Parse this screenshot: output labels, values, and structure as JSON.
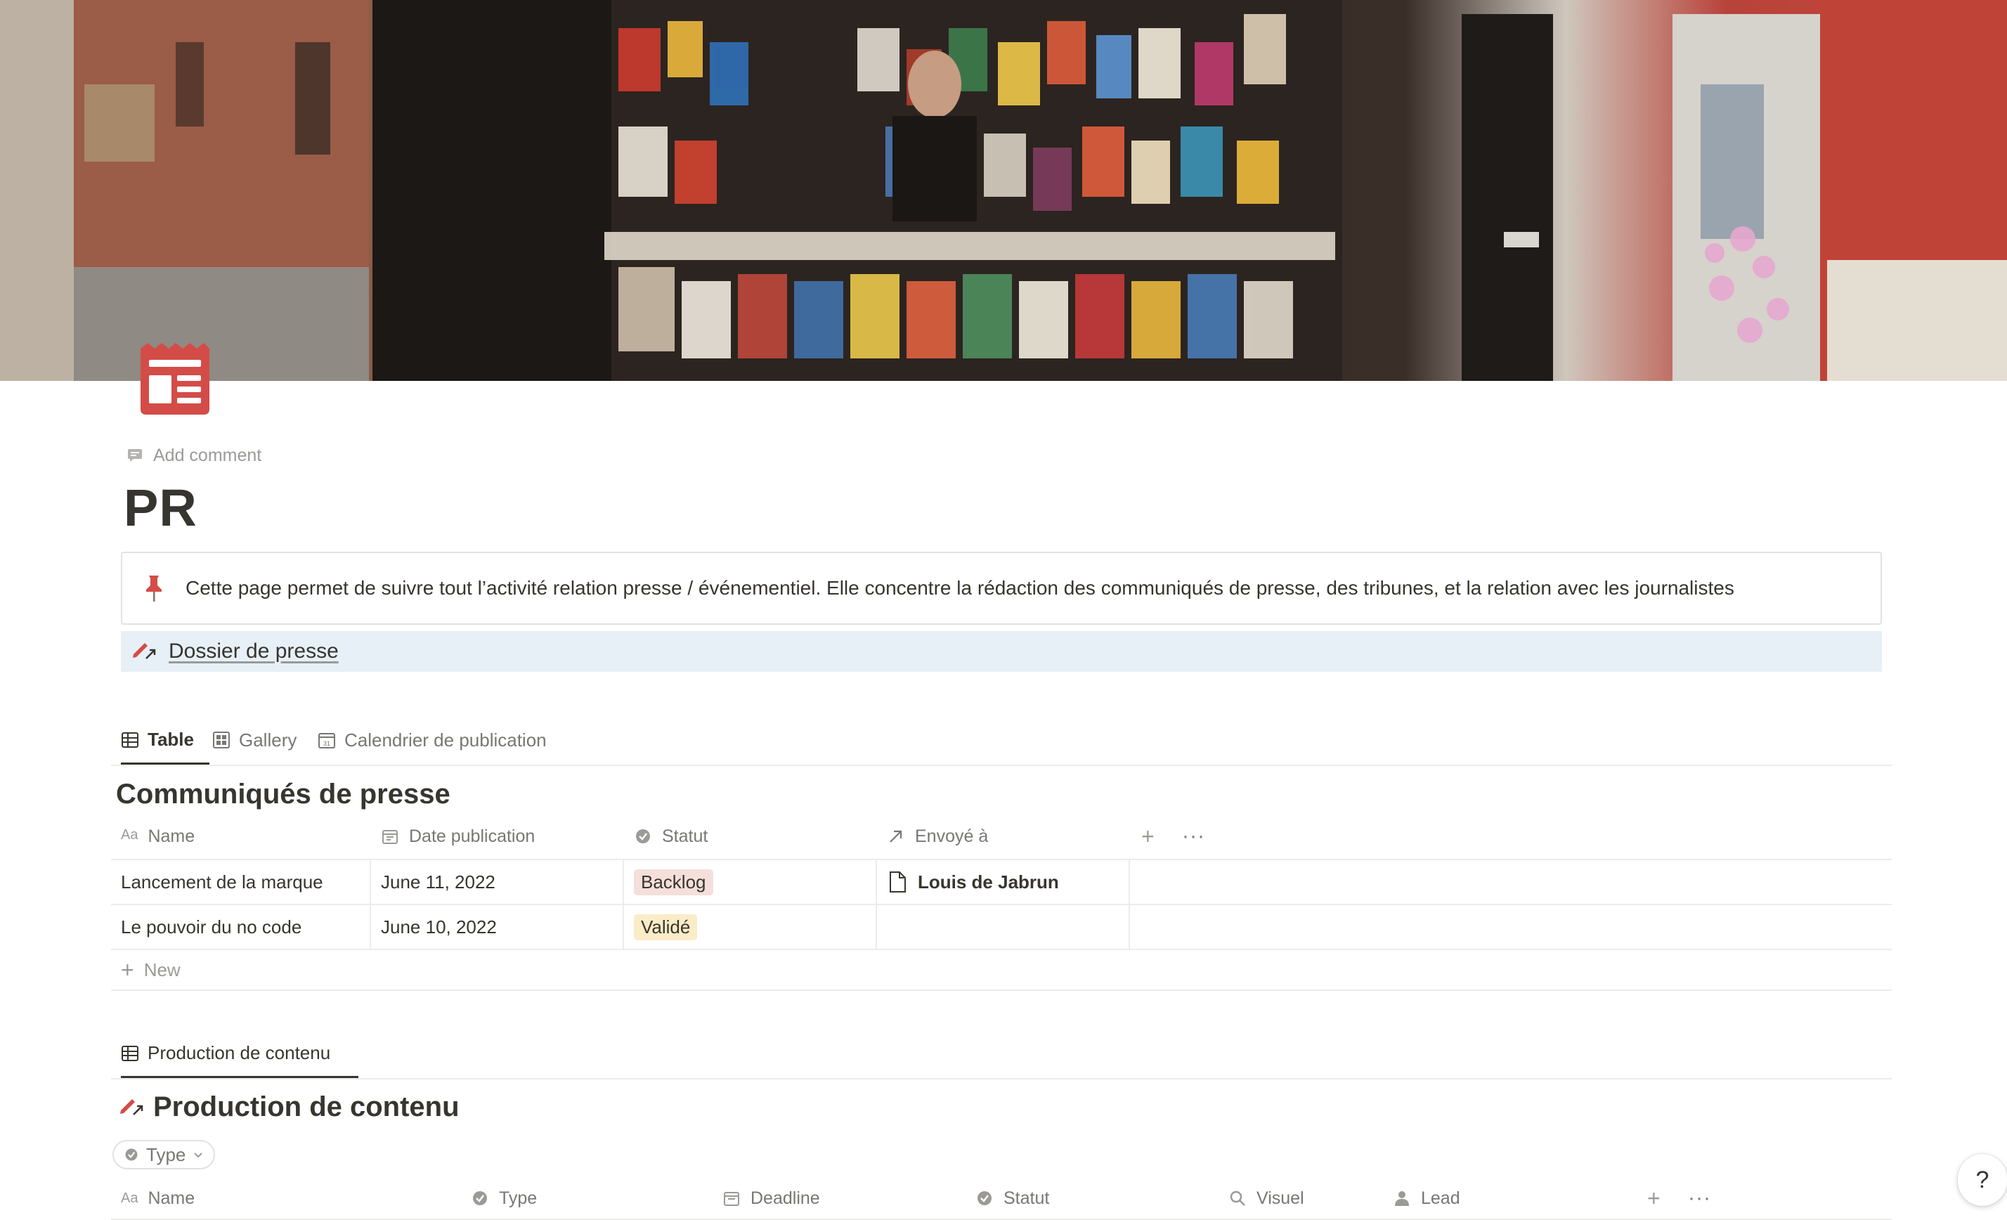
{
  "cover": {
    "alt": ""
  },
  "page": {
    "add_comment": "Add comment",
    "title": "PR"
  },
  "callout": {
    "text": "Cette page permet de suivre tout l’activité relation presse / événementiel. Elle concentre la rédaction des communiqués de presse, des tribunes, et la relation avec les journalistes"
  },
  "link_block": {
    "label": "Dossier de presse"
  },
  "views1": {
    "tabs": [
      {
        "label": "Table"
      },
      {
        "label": "Gallery"
      },
      {
        "label": "Calendrier de publication"
      }
    ]
  },
  "db1": {
    "title": "Communiqués de presse",
    "columns": [
      {
        "label": "Name"
      },
      {
        "label": "Date publication"
      },
      {
        "label": "Statut"
      },
      {
        "label": "Envoyé à"
      }
    ],
    "rows": [
      {
        "name": "Lancement de la marque",
        "date": "June 11, 2022",
        "statut": "Backlog",
        "envoye": "Louis de Jabrun"
      },
      {
        "name": "Le pouvoir du no code",
        "date": "June 10, 2022",
        "statut": "Validé",
        "envoye": ""
      }
    ],
    "new_label": "New",
    "tag_colors": {
      "Backlog": "#f4dfdb",
      "Validé": "#fbecc8"
    }
  },
  "views2": {
    "tabs": [
      {
        "label": "Production de contenu"
      }
    ]
  },
  "db2": {
    "title": "Production de contenu",
    "filter_label": "Type",
    "columns": [
      {
        "label": "Name"
      },
      {
        "label": "Type"
      },
      {
        "label": "Deadline"
      },
      {
        "label": "Statut"
      },
      {
        "label": "Visuel"
      },
      {
        "label": "Lead"
      }
    ]
  },
  "help": {
    "label": "?"
  },
  "colors": {
    "accent_red": "#d44c47",
    "link_bg": "#e7f0f7"
  }
}
